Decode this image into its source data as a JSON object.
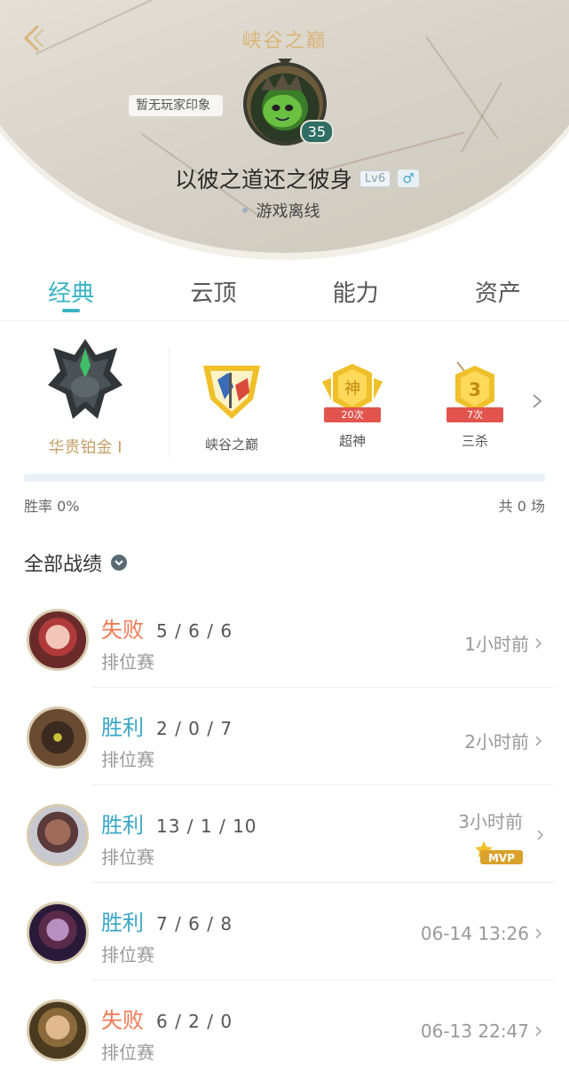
{
  "header": {
    "title": "峡谷之巅",
    "impression": "暂无玩家印象",
    "level_badge": "35",
    "nickname": "以彼之道还之彼身",
    "lv_tag": "Lv6",
    "gender_symbol": "♂",
    "status": "游戏离线"
  },
  "tabs": [
    {
      "label": "经典",
      "active": true
    },
    {
      "label": "云顶",
      "active": false
    },
    {
      "label": "能力",
      "active": false
    },
    {
      "label": "资产",
      "active": false
    }
  ],
  "rank": {
    "tier": "华贵铂金 I",
    "badges": [
      {
        "icon": "peak-crest-icon",
        "label": "峡谷之巅",
        "count": ""
      },
      {
        "icon": "godlike-badge-icon",
        "glyph": "神",
        "label": "超神",
        "count": "20次"
      },
      {
        "icon": "triple-kill-badge-icon",
        "glyph": "3",
        "label": "三杀",
        "count": "7次"
      }
    ]
  },
  "stats": {
    "win_rate": "胜率 0%",
    "total": "共 0 场"
  },
  "matches_title": "全部战绩",
  "matches": [
    {
      "result": "失败",
      "type": "loss",
      "kda": "5 / 6 / 6",
      "mode": "排位赛",
      "time": "1小时前",
      "mvp": false
    },
    {
      "result": "胜利",
      "type": "win",
      "kda": "2 / 0 / 7",
      "mode": "排位赛",
      "time": "2小时前",
      "mvp": false
    },
    {
      "result": "胜利",
      "type": "win",
      "kda": "13 / 1 / 10",
      "mode": "排位赛",
      "time": "3小时前",
      "mvp": true,
      "mvp_label": "MVP"
    },
    {
      "result": "胜利",
      "type": "win",
      "kda": "7 / 6 / 8",
      "mode": "排位赛",
      "time": "06-14 13:26",
      "mvp": false
    },
    {
      "result": "失败",
      "type": "loss",
      "kda": "6 / 2 / 0",
      "mode": "排位赛",
      "time": "06-13 22:47",
      "mvp": false
    }
  ],
  "colors": {
    "accent": "#39b3c4",
    "title_gold": "#d9b57a",
    "loss": "#f07a55",
    "win": "#3aa7c7",
    "rank_gold": "#c4a06a"
  }
}
